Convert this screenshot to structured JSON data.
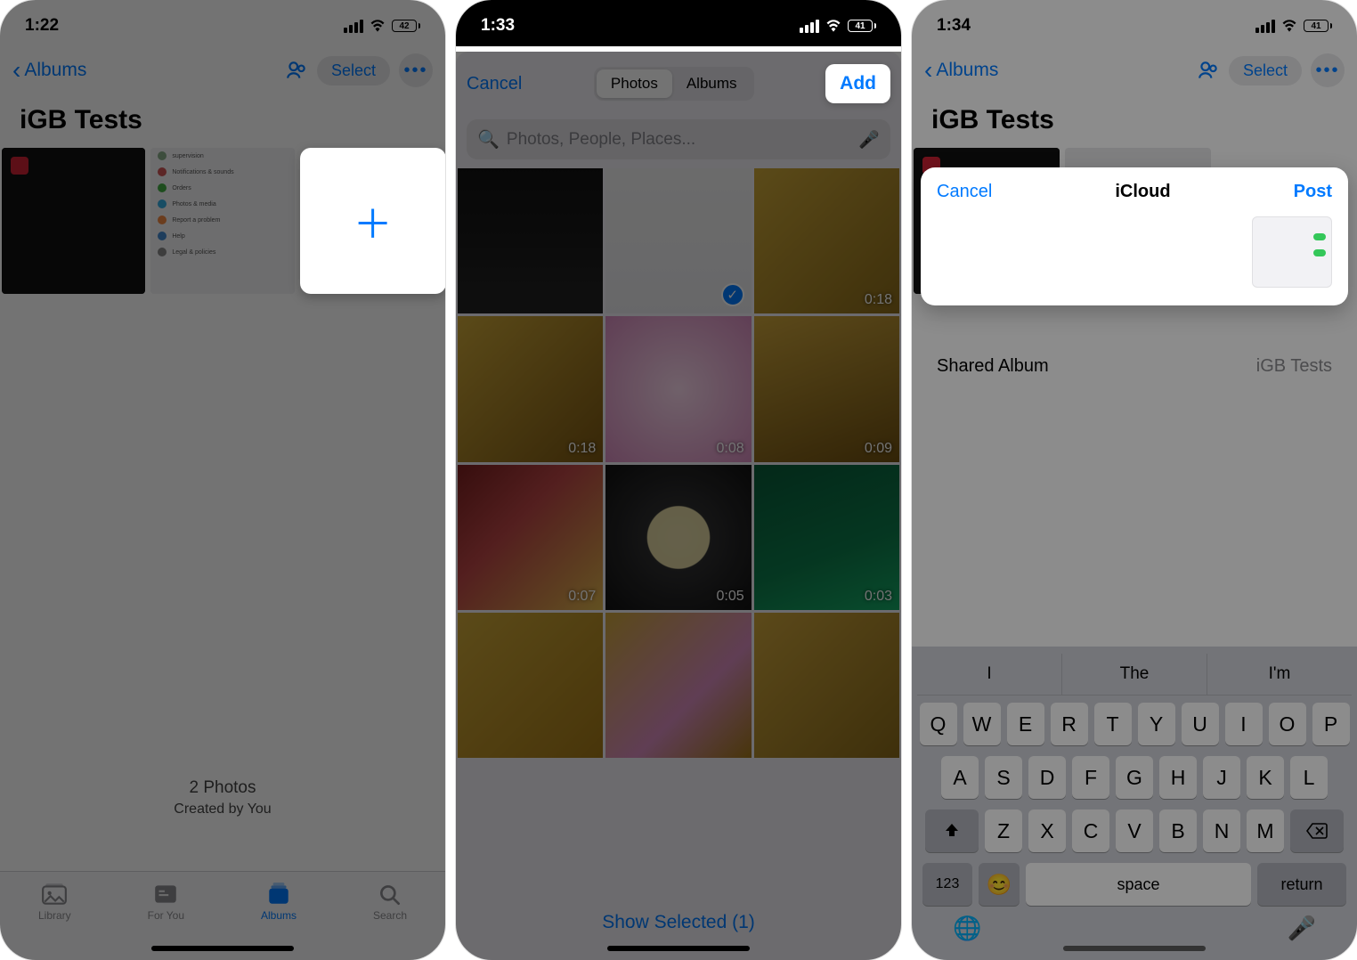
{
  "screen1": {
    "status": {
      "time": "1:22",
      "battery": "42"
    },
    "nav": {
      "back": "Albums",
      "select": "Select"
    },
    "album_title": "iGB Tests",
    "footer": {
      "count": "2 Photos",
      "created": "Created by You"
    },
    "tabs": {
      "library": "Library",
      "foryou": "For You",
      "albums": "Albums",
      "search": "Search"
    }
  },
  "screen2": {
    "status": {
      "time": "1:33",
      "battery": "41"
    },
    "nav": {
      "cancel": "Cancel",
      "seg_photos": "Photos",
      "seg_albums": "Albums",
      "add": "Add"
    },
    "search_placeholder": "Photos, People, Places...",
    "durations": [
      "0:18",
      "0:18",
      "0:08",
      "0:09",
      "0:07",
      "0:05",
      "0:03"
    ],
    "show_selected": "Show Selected (1)"
  },
  "screen3": {
    "status": {
      "time": "1:34",
      "battery": "41"
    },
    "nav": {
      "back": "Albums",
      "select": "Select"
    },
    "album_title": "iGB Tests",
    "icloud": {
      "cancel": "Cancel",
      "title": "iCloud",
      "post": "Post"
    },
    "shared": {
      "label": "Shared Album",
      "value": "iGB Tests"
    },
    "suggestions": [
      "I",
      "The",
      "I'm"
    ],
    "keys": {
      "r1": [
        "Q",
        "W",
        "E",
        "R",
        "T",
        "Y",
        "U",
        "I",
        "O",
        "P"
      ],
      "r2": [
        "A",
        "S",
        "D",
        "F",
        "G",
        "H",
        "J",
        "K",
        "L"
      ],
      "r3": [
        "Z",
        "X",
        "C",
        "V",
        "B",
        "N",
        "M"
      ],
      "num": "123",
      "space": "space",
      "return": "return"
    }
  }
}
